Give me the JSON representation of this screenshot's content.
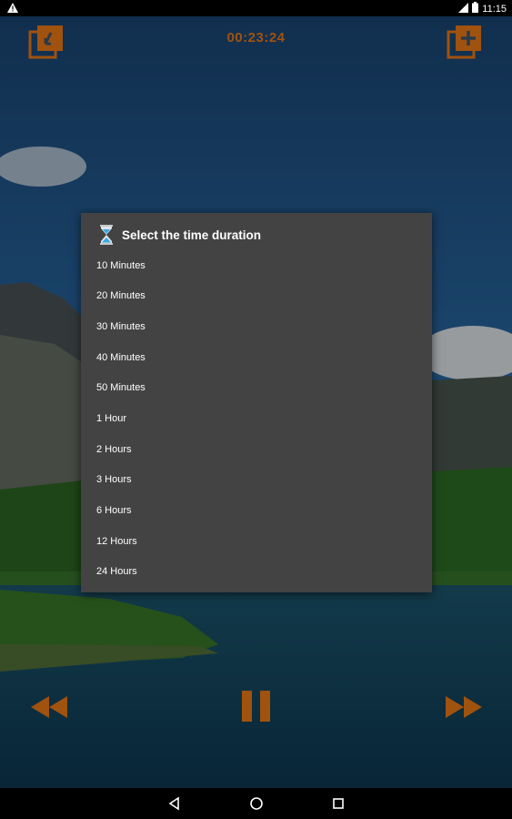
{
  "status_bar": {
    "time": "11:15",
    "icons": [
      "warning-icon",
      "signal-icon",
      "battery-icon"
    ]
  },
  "player": {
    "timer": "00:23:24",
    "top_left_icon": "collection-back-icon",
    "top_right_icon": "collection-add-icon",
    "controls": [
      "rewind-icon",
      "pause-icon",
      "fast-forward-icon"
    ],
    "accent_color": "#a0520f"
  },
  "dialog": {
    "title": "Select the time duration",
    "icon": "hourglass-icon",
    "options": [
      "10 Minutes",
      "20 Minutes",
      "30 Minutes",
      "40 Minutes",
      "50 Minutes",
      "1 Hour",
      "2 Hours",
      "3 Hours",
      "6 Hours",
      "12 Hours",
      "24 Hours"
    ],
    "background_color": "#434343"
  },
  "nav_bar": {
    "buttons": [
      "back-icon",
      "home-icon",
      "recents-icon"
    ]
  }
}
